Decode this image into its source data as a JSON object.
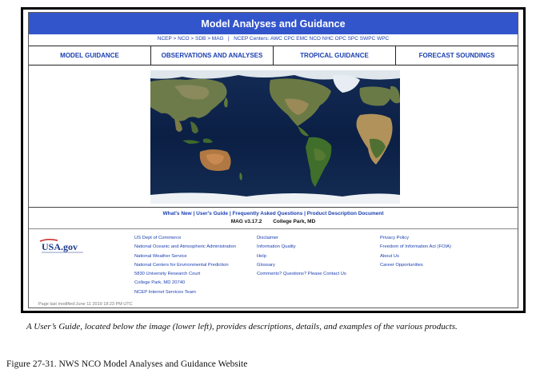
{
  "header": {
    "title": "Model Analyses and Guidance"
  },
  "breadcrumb": {
    "ncep": "NCEP",
    "nco": "NCO",
    "sdb": "SDB",
    "mag": "MAG",
    "separator": ">",
    "divider": "|",
    "centers_label": "NCEP Centers:",
    "centers": [
      "AWC",
      "CPC",
      "EMC",
      "NCO",
      "NHC",
      "OPC",
      "SPC",
      "SWPC",
      "WPC"
    ]
  },
  "nav": {
    "tabs": [
      {
        "label": "MODEL GUIDANCE"
      },
      {
        "label": "OBSERVATIONS AND ANALYSES"
      },
      {
        "label": "TROPICAL GUIDANCE"
      },
      {
        "label": "FORECAST SOUNDINGS"
      }
    ]
  },
  "links": {
    "whats_new": "What's New",
    "users_guide": "User's Guide",
    "faq": "Frequently Asked Questions",
    "product_doc": "Product Description Document",
    "separator": "|"
  },
  "version": {
    "label": "MAG v3.17.2",
    "location": "College Park, MD"
  },
  "footer": {
    "logo_text": "USA.gov",
    "col1": [
      "US Dept of Commerce",
      "National Oceanic and Atmospheric Administration",
      "National Weather Service",
      "National Centers for Environmental Prediction",
      "5830 University Research Court",
      "College Park, MD 20740",
      "NCEP Internet Services Team"
    ],
    "col2": [
      "Disclaimer",
      "Information Quality",
      "Help",
      "Glossary",
      "Comments? Questions? Please Contact Us"
    ],
    "col3": [
      "Privacy Policy",
      "Freedom of Information Act (FOIA)",
      "About Us",
      "Career Opportunities"
    ],
    "modified": "Page last modified:June 11 2019 18:23 PM UTC"
  },
  "caption": "A User’s Guide, located below the image (lower left), provides descriptions, details, and examples of the various products.",
  "figure_title": "Figure 27-31. NWS NCO Model Analyses and Guidance Website",
  "colors": {
    "banner": "#3355cc",
    "link": "#1a3fb0",
    "ocean": "#0d2347"
  }
}
